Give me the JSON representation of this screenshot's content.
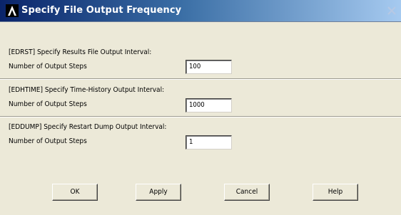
{
  "window": {
    "title": "Specify File Output Frequency",
    "logo_icon": "ansys-lambda-logo",
    "close_icon": "close-x-icon"
  },
  "sections": [
    {
      "heading": "[EDRST]  Specify Results File Output Interval:",
      "field_label": "Number of Output Steps",
      "value": "100"
    },
    {
      "heading": "[EDHTIME]  Specify Time-History Output Interval:",
      "field_label": "Number of Output Steps",
      "value": "1000"
    },
    {
      "heading": "[EDDUMP]  Specify Restart Dump Output Interval:",
      "field_label": "Number of Output Steps",
      "value": "1"
    }
  ],
  "buttons": {
    "ok": "OK",
    "apply": "Apply",
    "cancel": "Cancel",
    "help": "Help"
  },
  "colors": {
    "dialog_bg": "#ece9d8",
    "titlebar_start": "#0a246a",
    "titlebar_end": "#a6caf0",
    "title_text": "#ffffff"
  }
}
